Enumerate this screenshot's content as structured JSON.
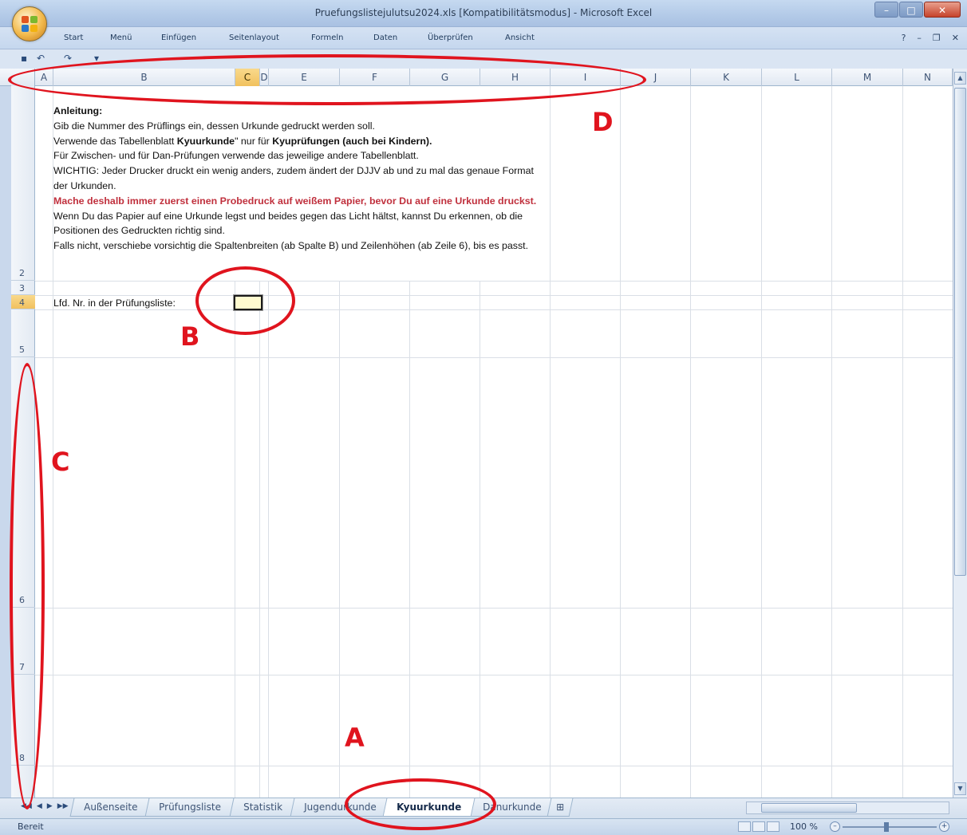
{
  "window": {
    "title": "Pruefungslistejulutsu2024.xls [Kompatibilitätsmodus] - Microsoft Excel",
    "min": "–",
    "max": "□",
    "close": "✕"
  },
  "ribbon": {
    "tabs": [
      "Start",
      "Menü",
      "Einfügen",
      "Seitenlayout",
      "Formeln",
      "Daten",
      "Überprüfen",
      "Ansicht"
    ],
    "help": "?",
    "doc_min": "–",
    "doc_restore": "❐",
    "doc_close": "✕"
  },
  "qat": {
    "save": "▪",
    "undo": "↶",
    "redo": "↷",
    "more": "▾"
  },
  "columns": [
    "A",
    "B",
    "C",
    "D",
    "E",
    "F",
    "G",
    "H",
    "I",
    "J",
    "K",
    "L",
    "M",
    "N"
  ],
  "rows": [
    "2",
    "3",
    "4",
    "5",
    "6",
    "7",
    "8"
  ],
  "selected_column": "C",
  "selected_row": "4",
  "instructions": {
    "heading": "Anleitung:",
    "l1": "Gib die Nummer des Prüflings ein, dessen Urkunde gedruckt werden soll.",
    "l2a": "Verwende das Tabellenblatt ",
    "l2b": "Kyuurkunde",
    "l2c": "\" nur für ",
    "l2d": "Kyuprüfungen (auch bei Kindern).",
    "l3": "Für Zwischen- und für Dan-Prüfungen verwende das jeweilige andere Tabellenblatt.",
    "l4": "WICHTIG: Jeder Drucker druckt ein wenig anders, zudem ändert der DJJV ab und zu mal das genaue Format der Urkunden.",
    "l5": "Mache deshalb immer zuerst einen Probedruck auf weißem Papier, bevor Du auf eine Urkunde druckst.",
    "l6": "Wenn Du das Papier auf eine Urkunde legst und beides gegen das Licht hältst, kannst Du erkennen, ob die Positionen des Gedruckten richtig sind.",
    "l7": "Falls nicht, verschiebe vorsichtig die Spaltenbreiten (ab Spalte B) und Zeilenhöhen (ab Zeile 6), bis es passt."
  },
  "row4_label": "Lfd. Nr. in der Prüfungsliste:",
  "sheet_tabs": [
    "Außenseite",
    "Prüfungsliste",
    "Statistik",
    "Jugendurkunde",
    "Kyuurkunde",
    "Danurkunde"
  ],
  "active_sheet": "Kyuurkunde",
  "sheet_nav": [
    "◀◀",
    "◀",
    "▶",
    "▶▶"
  ],
  "status": {
    "ready": "Bereit",
    "zoom": "100 %",
    "zoom_minus": "–",
    "zoom_plus": "+"
  },
  "annotations": [
    "A",
    "B",
    "C",
    "D"
  ],
  "colors": {
    "annotation": "#e0141e",
    "selected_header": "#f1c15e",
    "input_cell": "#fffbd0",
    "warning_text": "#c0303d"
  }
}
